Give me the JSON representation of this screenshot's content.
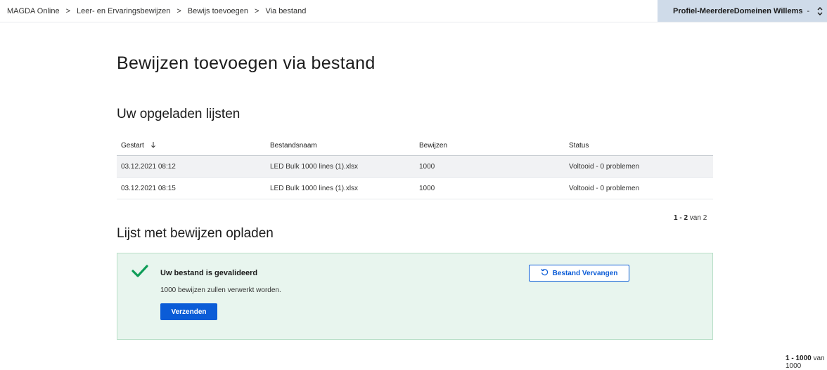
{
  "breadcrumb": [
    "MAGDA Online",
    "Leer- en Ervaringsbewijzen",
    "Bewijs toevoegen",
    "Via bestand"
  ],
  "profile": {
    "name": "Profiel-MeerdereDomeinen Willems",
    "dash": "-"
  },
  "page_title": "Bewijzen toevoegen via bestand",
  "uploads": {
    "title": "Uw opgeladen lijsten",
    "columns": [
      "Gestart",
      "Bestandsnaam",
      "Bewijzen",
      "Status"
    ],
    "rows": [
      [
        "03.12.2021 08:12",
        "LED Bulk 1000 lines (1).xlsx",
        "1000",
        "Voltooid - 0 problemen"
      ],
      [
        "03.12.2021 08:15",
        "LED Bulk 1000 lines (1).xlsx",
        "1000",
        "Voltooid - 0 problemen"
      ]
    ],
    "pager": {
      "range": "1 - 2",
      "of": "van 2"
    }
  },
  "upload_section": {
    "title": "Lijst met bewijzen opladen",
    "alert_title": "Uw bestand is gevalideerd",
    "alert_text": "1000 bewijzen zullen verwerkt worden.",
    "submit_label": "Verzenden",
    "replace_label": "Bestand Vervangen"
  },
  "bottom_pager": {
    "range": "1 - 1000",
    "of": "van 1000"
  },
  "colors": {
    "primary": "#0b5cd7",
    "success": "#0f9d58",
    "alert_bg": "#e8f5ee",
    "profile_bg": "#cfdbe9"
  },
  "icons": {
    "sort": "arrow-down-icon",
    "check": "check-icon",
    "replace": "refresh-icon",
    "switch": "chevron-updown-icon"
  }
}
